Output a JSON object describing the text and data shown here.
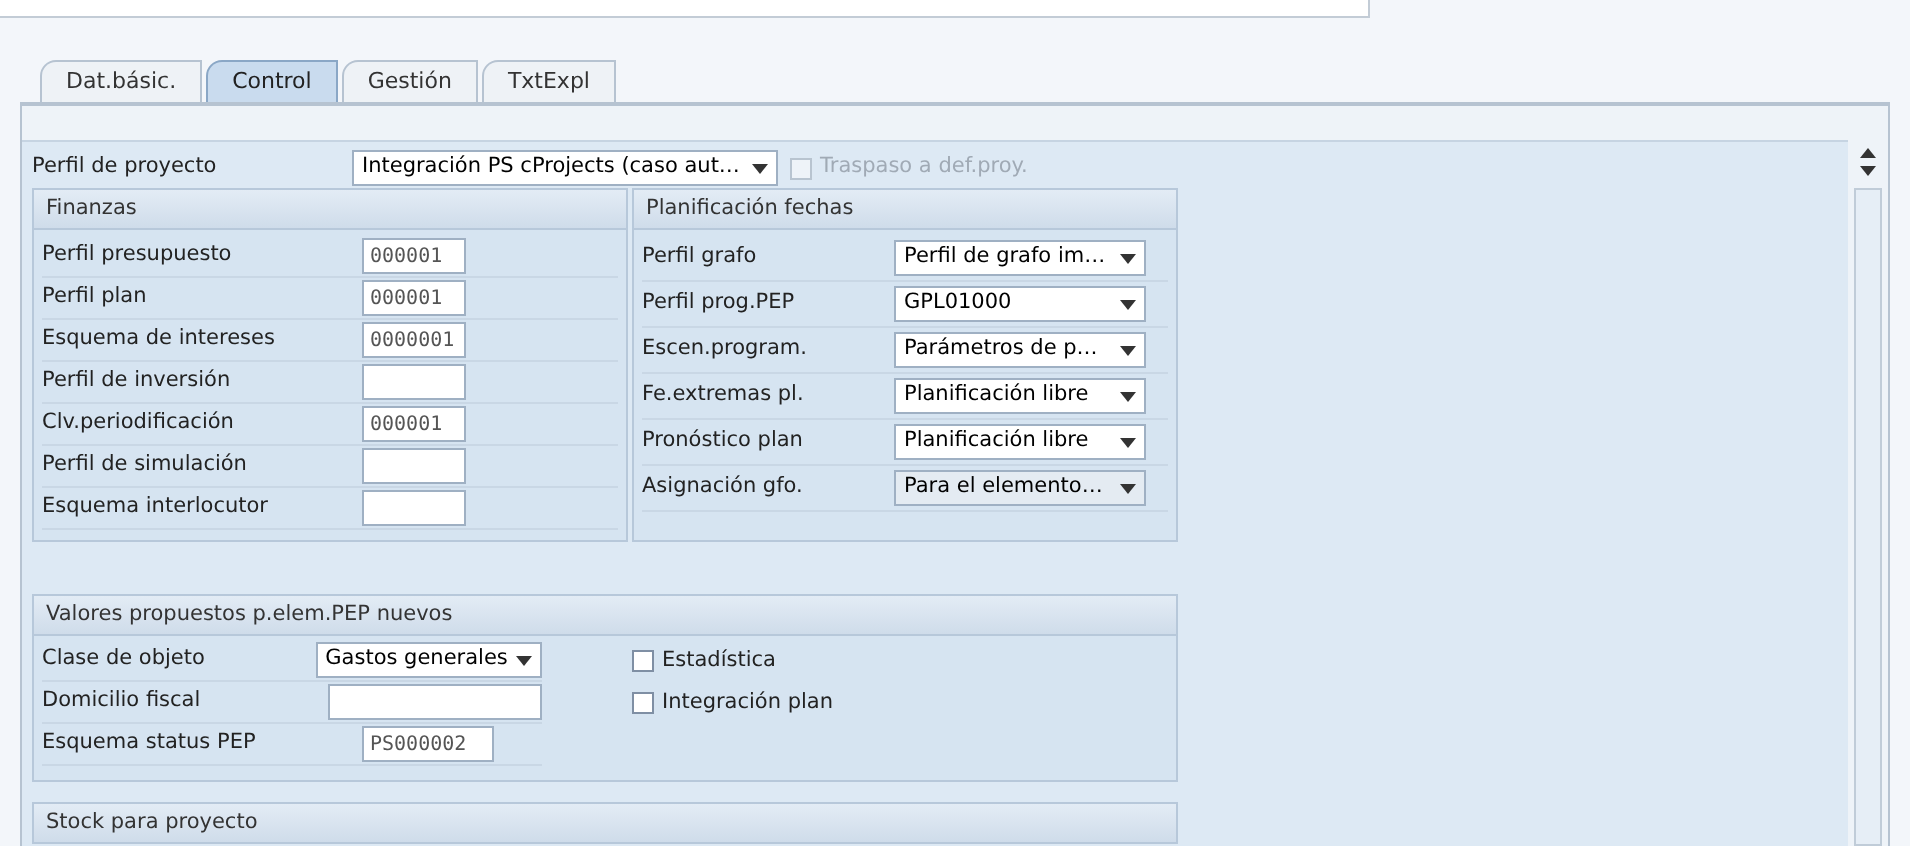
{
  "tabs": [
    {
      "label": "Dat.básic.",
      "selected": false
    },
    {
      "label": "Control",
      "selected": true
    },
    {
      "label": "Gestión",
      "selected": false
    },
    {
      "label": "TxtExpl",
      "selected": false
    }
  ],
  "project_profile": {
    "label": "Perfil de proyecto",
    "value": "Integración PS cProjects (caso aut…",
    "transfer": {
      "label": "Traspaso a def.proy.",
      "checked": false,
      "disabled": true
    }
  },
  "finance": {
    "title": "Finanzas",
    "fields": [
      {
        "label": "Perfil presupuesto",
        "value": "000001"
      },
      {
        "label": "Perfil plan",
        "value": "000001"
      },
      {
        "label": "Esquema de intereses",
        "value": "0000001"
      },
      {
        "label": "Perfil de inversión"
      },
      {
        "label": "Clv.periodificación",
        "value": "000001"
      },
      {
        "label": "Perfil de simulación"
      },
      {
        "label": "Esquema interlocutor"
      }
    ]
  },
  "scheduling": {
    "title": "Planificación fechas",
    "fields": [
      {
        "label": "Perfil grafo",
        "value": "Perfil de grafo im…",
        "disabled": false
      },
      {
        "label": "Perfil prog.PEP",
        "value": "GPL01000",
        "disabled": false
      },
      {
        "label": "Escen.program.",
        "value": "Parámetros de p…",
        "disabled": false
      },
      {
        "label": "Fe.extremas pl.",
        "value": "Planificación libre",
        "disabled": false
      },
      {
        "label": "Pronóstico plan",
        "value": "Planificación libre",
        "disabled": false
      },
      {
        "label": "Asignación gfo.",
        "value": "Para el elemento…",
        "disabled": true
      }
    ]
  },
  "wbs_defaults": {
    "title": "Valores propuestos p.elem.PEP nuevos",
    "fields": [
      {
        "label": "Clase de objeto",
        "kind": "dropdown",
        "value": "Gastos generales"
      },
      {
        "label": "Domicilio fiscal",
        "kind": "input"
      },
      {
        "label": "Esquema status PEP",
        "kind": "input",
        "value": "PS000002"
      }
    ],
    "checkboxes": [
      {
        "label": "Estadística",
        "checked": false
      },
      {
        "label": "Integración plan",
        "checked": false
      }
    ]
  },
  "stock": {
    "title": "Stock para proyecto"
  }
}
